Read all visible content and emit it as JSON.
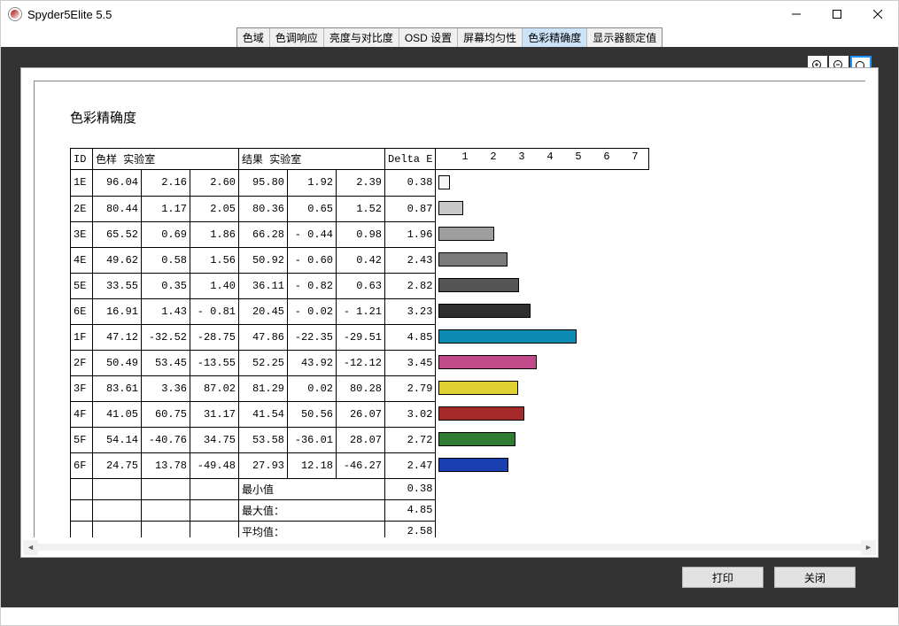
{
  "window": {
    "title": "Spyder5Elite 5.5"
  },
  "tabs": {
    "items": [
      {
        "label": "色域"
      },
      {
        "label": "色调响应"
      },
      {
        "label": "亮度与对比度"
      },
      {
        "label": "OSD 设置"
      },
      {
        "label": "屏幕均匀性"
      },
      {
        "label": "色彩精确度",
        "selected": true
      },
      {
        "label": "显示器额定值"
      }
    ]
  },
  "page": {
    "title": "色彩精确度"
  },
  "table": {
    "headers": {
      "id": "ID",
      "sample": "色样",
      "sample_lab": "实验室",
      "result": "结果",
      "result_lab": "实验室",
      "delta": "Delta E"
    },
    "summary_labels": {
      "min": "最小值",
      "max": "最大值：",
      "avg": "平均值："
    }
  },
  "chart_data": {
    "type": "bar",
    "title": "色彩精确度",
    "xlabel": "Delta E",
    "xlim": [
      0,
      7.5
    ],
    "ticks": [
      1,
      2,
      3,
      4,
      5,
      6,
      7
    ],
    "categories": [
      "1E",
      "2E",
      "3E",
      "4E",
      "5E",
      "6E",
      "1F",
      "2F",
      "3F",
      "4F",
      "5F",
      "6F"
    ],
    "rows": [
      {
        "id": "1E",
        "s1": 96.04,
        "s2": 2.16,
        "s3": 2.6,
        "r1": 95.8,
        "r2": 1.92,
        "r3": 2.39,
        "delta": 0.38,
        "color": "#f5f5f5"
      },
      {
        "id": "2E",
        "s1": 80.44,
        "s2": 1.17,
        "s3": 2.05,
        "r1": 80.36,
        "r2": 0.65,
        "r3": 1.52,
        "delta": 0.87,
        "color": "#c8c8c8"
      },
      {
        "id": "3E",
        "s1": 65.52,
        "s2": 0.69,
        "s3": 1.86,
        "r1": 66.28,
        "r2": -0.44,
        "r3": 0.98,
        "delta": 1.96,
        "color": "#9e9e9e"
      },
      {
        "id": "4E",
        "s1": 49.62,
        "s2": 0.58,
        "s3": 1.56,
        "r1": 50.92,
        "r2": -0.6,
        "r3": 0.42,
        "delta": 2.43,
        "color": "#7a7a7a"
      },
      {
        "id": "5E",
        "s1": 33.55,
        "s2": 0.35,
        "s3": 1.4,
        "r1": 36.11,
        "r2": -0.82,
        "r3": 0.63,
        "delta": 2.82,
        "color": "#555555"
      },
      {
        "id": "6E",
        "s1": 16.91,
        "s2": 1.43,
        "s3": -0.81,
        "r1": 20.45,
        "r2": -0.02,
        "r3": -1.21,
        "delta": 3.23,
        "color": "#2f2f2f"
      },
      {
        "id": "1F",
        "s1": 47.12,
        "s2": -32.52,
        "s3": -28.75,
        "r1": 47.86,
        "r2": -22.35,
        "r3": -29.51,
        "delta": 4.85,
        "color": "#0f8ab2"
      },
      {
        "id": "2F",
        "s1": 50.49,
        "s2": 53.45,
        "s3": -13.55,
        "r1": 52.25,
        "r2": 43.92,
        "r3": -12.12,
        "delta": 3.45,
        "color": "#c24a8a"
      },
      {
        "id": "3F",
        "s1": 83.61,
        "s2": 3.36,
        "s3": 87.02,
        "r1": 81.29,
        "r2": 0.02,
        "r3": 80.28,
        "delta": 2.79,
        "color": "#e0d132"
      },
      {
        "id": "4F",
        "s1": 41.05,
        "s2": 60.75,
        "s3": 31.17,
        "r1": 41.54,
        "r2": 50.56,
        "r3": 26.07,
        "delta": 3.02,
        "color": "#a52a2a"
      },
      {
        "id": "5F",
        "s1": 54.14,
        "s2": -40.76,
        "s3": 34.75,
        "r1": 53.58,
        "r2": -36.01,
        "r3": 28.07,
        "delta": 2.72,
        "color": "#2e7d32"
      },
      {
        "id": "6F",
        "s1": 24.75,
        "s2": 13.78,
        "s3": -49.48,
        "r1": 27.93,
        "r2": 12.18,
        "r3": -46.27,
        "delta": 2.47,
        "color": "#1a3fb0"
      }
    ],
    "summary": {
      "min": 0.38,
      "max": 4.85,
      "avg": 2.58
    }
  },
  "buttons": {
    "print": "打印",
    "close": "关闭"
  }
}
